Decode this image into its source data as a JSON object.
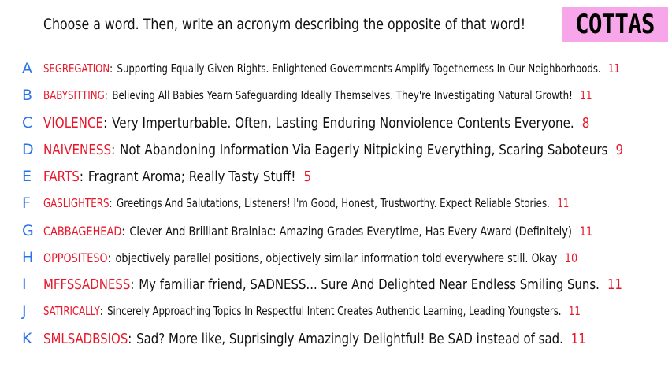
{
  "header": {
    "instruction": "Choose a word. Then, write an acronym describing the opposite of that word!"
  },
  "badge": {
    "label": "COTTAS"
  },
  "colors": {
    "letter": "#2b73e8",
    "word": "#e8172a",
    "badge_bg": "#f7a6ea"
  },
  "rows": [
    {
      "letter": "A",
      "word": "SEGREGATION",
      "acronym": "Supporting Equally Given Rights. Enlightened Governments Amplify Togetherness In Our Neighborhoods.",
      "count": "11"
    },
    {
      "letter": "B",
      "word": "BABYSITTING",
      "acronym": "Believing All Babies Yearn Safeguarding Ideally Themselves. They're Investigating Natural Growth!",
      "count": "11"
    },
    {
      "letter": "C",
      "word": "VIOLENCE",
      "acronym": "Very Imperturbable. Often, Lasting Enduring Nonviolence Contents Everyone.",
      "count": "8"
    },
    {
      "letter": "D",
      "word": "NAIVENESS",
      "acronym": "Not Abandoning Information Via Eagerly Nitpicking Everything, Scaring Saboteurs",
      "count": "9"
    },
    {
      "letter": "E",
      "word": "FARTS",
      "acronym": "Fragrant Aroma; Really Tasty Stuff!",
      "count": "5"
    },
    {
      "letter": "F",
      "word": "GASLIGHTERS",
      "acronym": "Greetings And Salutations, Listeners! I'm Good, Honest, Trustworthy. Expect Reliable Stories.",
      "count": "11"
    },
    {
      "letter": "G",
      "word": "CABBAGEHEAD",
      "acronym": "Clever And Brilliant Brainiac: Amazing Grades Everytime, Has Every Award (Definitely)",
      "count": "11"
    },
    {
      "letter": "H",
      "word": "OPPOSITESO",
      "acronym": "objectively parallel positions, objectively similar information told everywhere still. Okay",
      "count": "10"
    },
    {
      "letter": "I",
      "word": "MFFSSADNESS",
      "acronym": "My familiar friend, SADNESS... Sure And Delighted Near Endless Smiling Suns.",
      "count": "11"
    },
    {
      "letter": "J",
      "word": "SATIRICALLY",
      "acronym": "Sincerely Approaching Topics In Respectful Intent Creates Authentic Learning, Leading Youngsters.",
      "count": "11"
    },
    {
      "letter": "K",
      "word": "SMLSADBSIOS",
      "acronym": "Sad? More like, Suprisingly Amazingly Delightful! Be SAD instead of sad.",
      "count": "11"
    }
  ]
}
